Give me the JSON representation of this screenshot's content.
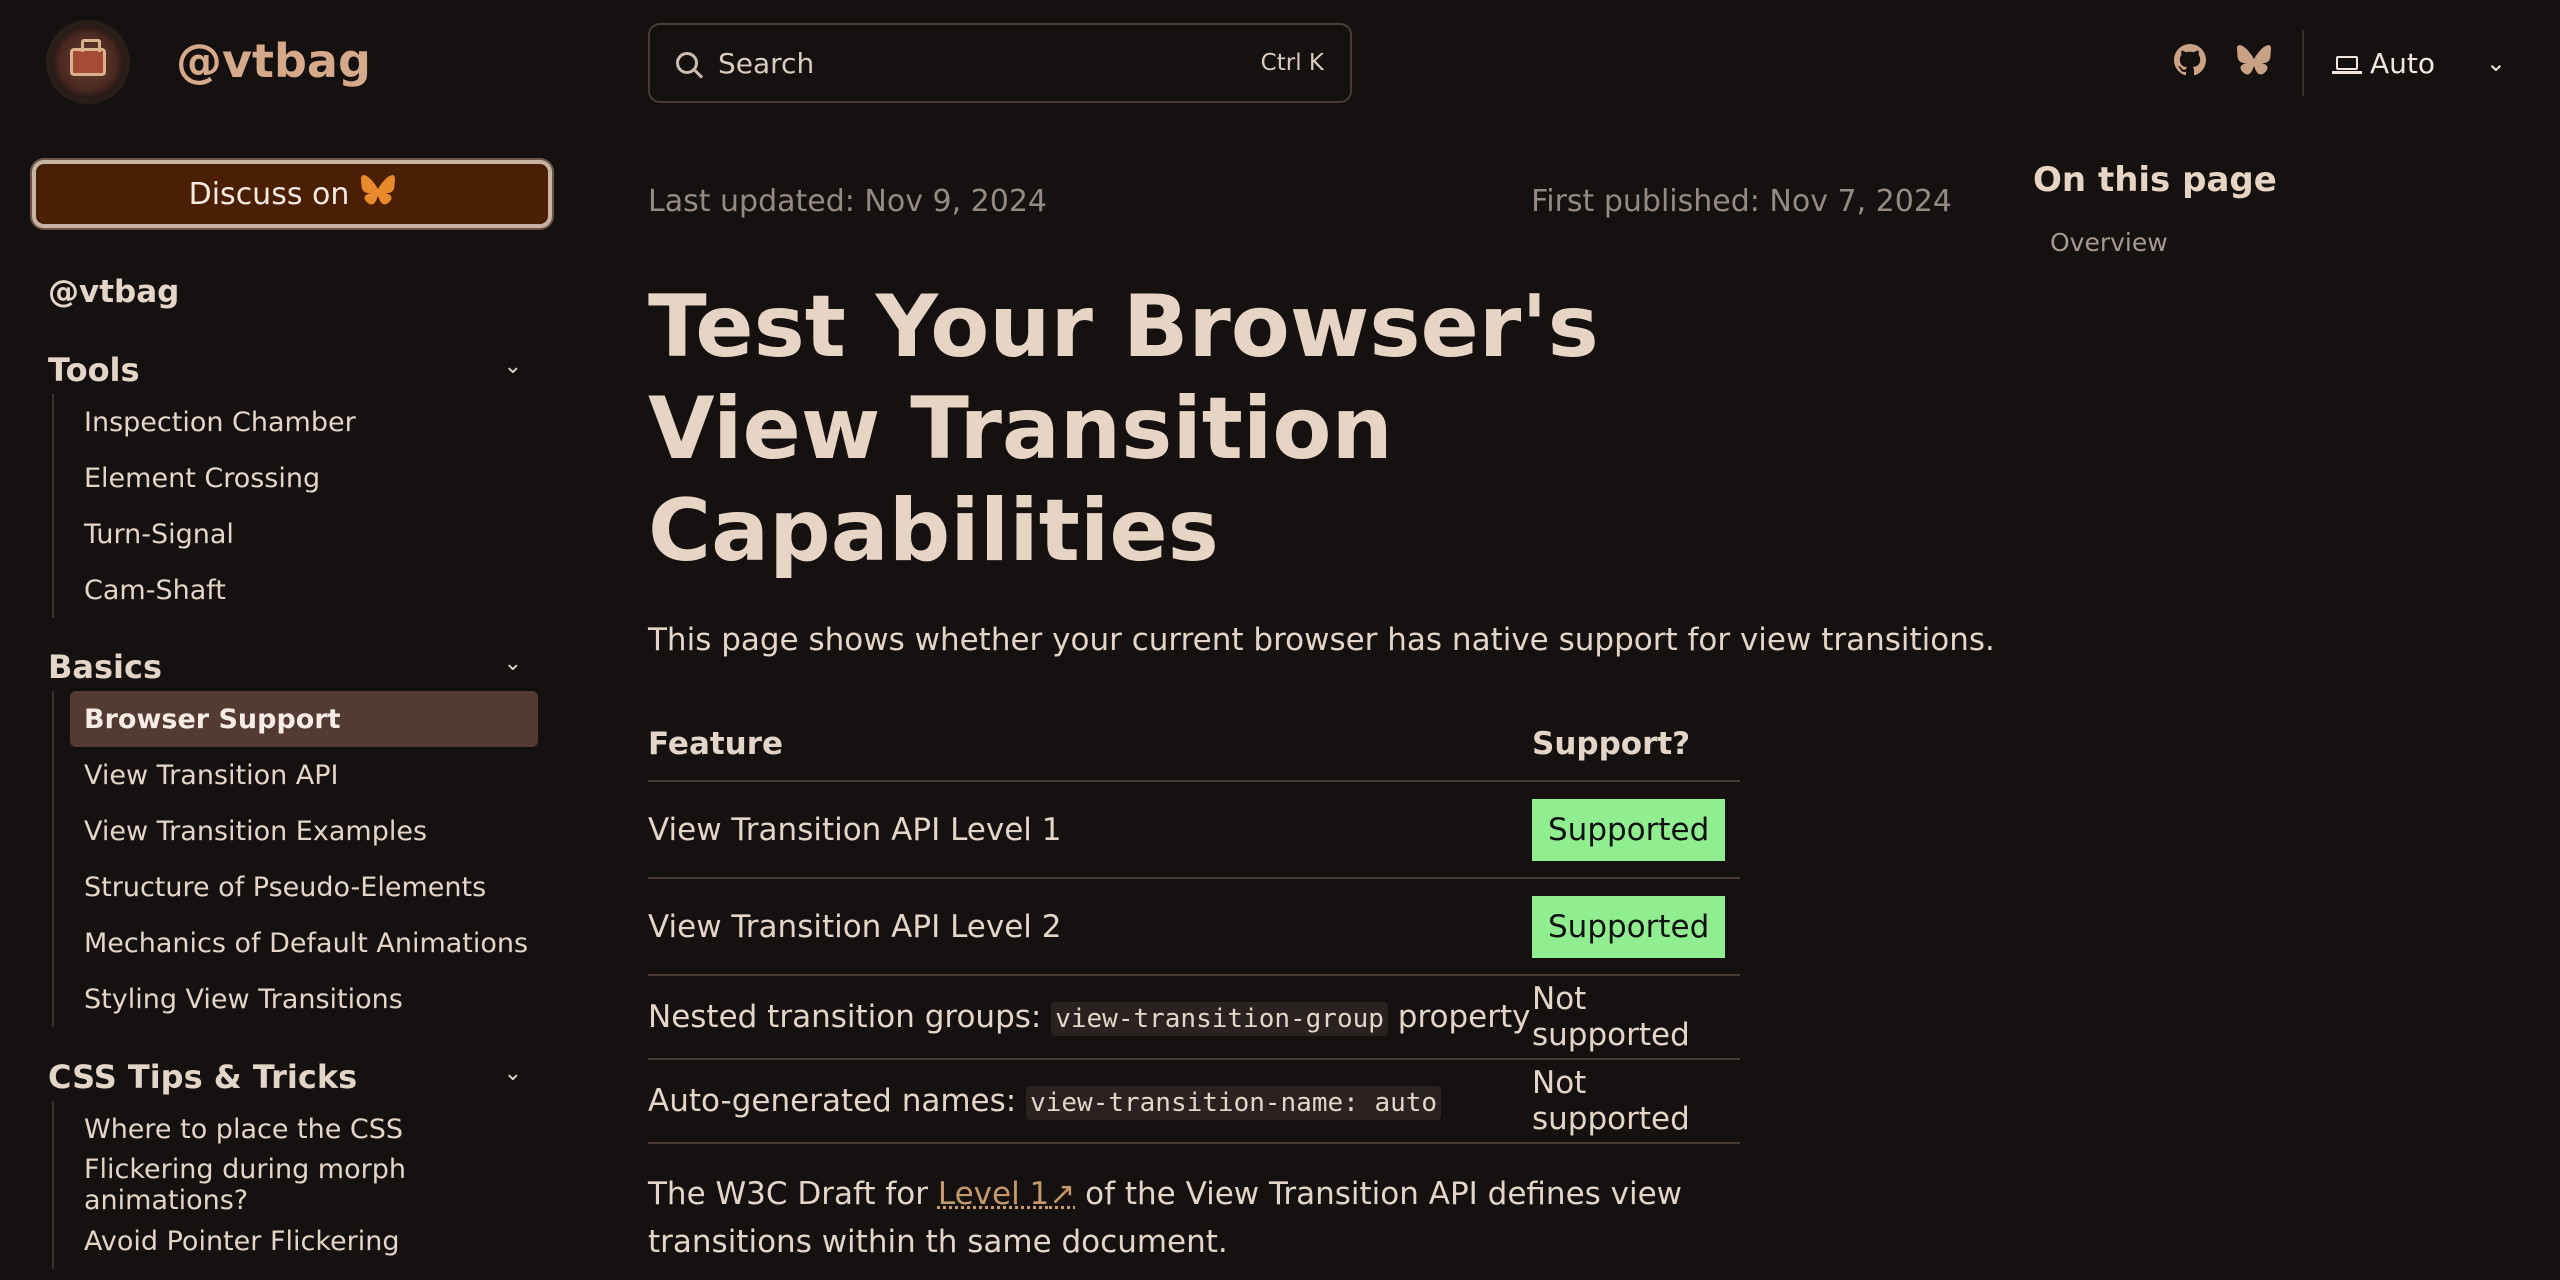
{
  "header": {
    "brand": "@vtbag",
    "search_placeholder": "Search",
    "search_shortcut": "Ctrl K",
    "theme_label": "Auto"
  },
  "sidebar": {
    "discuss_label": "Discuss on",
    "top_link": "@vtbag",
    "groups": [
      {
        "title": "Tools",
        "items": [
          "Inspection Chamber",
          "Element Crossing",
          "Turn-Signal",
          "Cam-Shaft"
        ]
      },
      {
        "title": "Basics",
        "items": [
          "Browser Support",
          "View Transition API",
          "View Transition Examples",
          "Structure of Pseudo-Elements",
          "Mechanics of Default Animations",
          "Styling View Transitions"
        ]
      },
      {
        "title": "CSS Tips & Tricks",
        "items": [
          "Where to place the CSS",
          "Flickering during morph animations?",
          "Avoid Pointer Flickering"
        ]
      }
    ]
  },
  "main": {
    "last_updated": "Last updated: Nov 9, 2024",
    "first_published": "First published: Nov 7, 2024",
    "title": "Test Your Browser's View Transition Capabilities",
    "intro": "This page shows whether your current browser has native support for view transitions.",
    "table": {
      "headers": [
        "Feature",
        "Support?"
      ],
      "rows": [
        {
          "feature": "View Transition API Level 1",
          "support": "Supported"
        },
        {
          "feature": "View Transition API Level 2",
          "support": "Supported"
        },
        {
          "feature_pre": "Nested transition groups: ",
          "feature_code": "view-transition-group",
          "feature_post": " property",
          "support": "Not supported"
        },
        {
          "feature_pre": "Auto-generated names: ",
          "feature_code": "view-transition-name: auto",
          "support": "Not supported"
        }
      ]
    },
    "para_pre": "The W3C Draft for ",
    "para_link": "Level 1",
    "para_post": " of the View Transition API defines view transitions within th same document."
  },
  "toc": {
    "title": "On this page",
    "items": [
      "Overview"
    ]
  },
  "colors": {
    "background": "#141110",
    "accent": "#d7a98b",
    "supported_badge": "#90ee90",
    "active_item": "#533a33"
  }
}
